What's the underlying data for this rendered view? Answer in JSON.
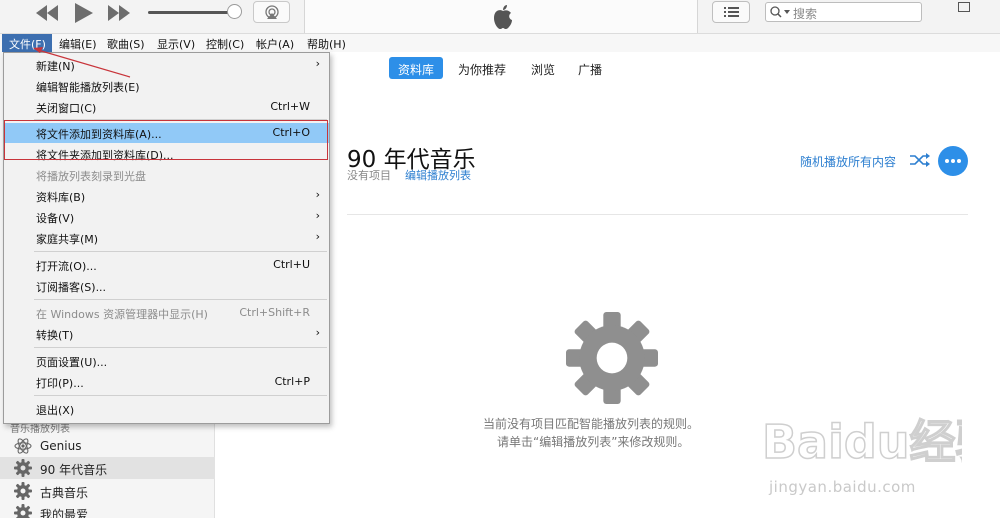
{
  "toolbar": {
    "search_placeholder": "搜索",
    "icons": [
      "rewind-icon",
      "play-icon",
      "fast-forward-icon",
      "airplay-icon",
      "apple-logo",
      "list-view-icon",
      "search-icon"
    ]
  },
  "menubar": {
    "items": [
      "文件(F)",
      "编辑(E)",
      "歌曲(S)",
      "显示(V)",
      "控制(C)",
      "帐户(A)",
      "帮助(H)"
    ]
  },
  "file_menu": {
    "items": [
      {
        "label": "新建(N)",
        "shortcut": "",
        "submenu": true,
        "disabled": false
      },
      {
        "label": "编辑智能播放列表(E)",
        "shortcut": "",
        "submenu": false,
        "disabled": false
      },
      {
        "label": "关闭窗口(C)",
        "shortcut": "Ctrl+W",
        "submenu": false,
        "disabled": false
      },
      {
        "label": "将文件添加到资料库(A)...",
        "shortcut": "Ctrl+O",
        "submenu": false,
        "disabled": false,
        "highlighted": true
      },
      {
        "label": "将文件夹添加到资料库(D)...",
        "shortcut": "",
        "submenu": false,
        "disabled": false
      },
      {
        "label": "将播放列表刻录到光盘",
        "shortcut": "",
        "submenu": false,
        "disabled": true
      },
      {
        "label": "资料库(B)",
        "shortcut": "",
        "submenu": true,
        "disabled": false
      },
      {
        "label": "设备(V)",
        "shortcut": "",
        "submenu": true,
        "disabled": false
      },
      {
        "label": "家庭共享(M)",
        "shortcut": "",
        "submenu": true,
        "disabled": false
      },
      {
        "label": "打开流(O)...",
        "shortcut": "Ctrl+U",
        "submenu": false,
        "disabled": false
      },
      {
        "label": "订阅播客(S)...",
        "shortcut": "",
        "submenu": false,
        "disabled": false
      },
      {
        "label": "在 Windows 资源管理器中显示(H)",
        "shortcut": "Ctrl+Shift+R",
        "submenu": false,
        "disabled": true
      },
      {
        "label": "转换(T)",
        "shortcut": "",
        "submenu": true,
        "disabled": false
      },
      {
        "label": "页面设置(U)...",
        "shortcut": "",
        "submenu": false,
        "disabled": false
      },
      {
        "label": "打印(P)...",
        "shortcut": "Ctrl+P",
        "submenu": false,
        "disabled": false
      },
      {
        "label": "退出(X)",
        "shortcut": "",
        "submenu": false,
        "disabled": false
      }
    ]
  },
  "tabs": [
    "资料库",
    "为你推荐",
    "浏览",
    "广播"
  ],
  "active_tab": "资料库",
  "sidebar": {
    "section_title": "音乐播放列表",
    "items": [
      {
        "label": "Genius",
        "icon": "genius-atom-icon"
      },
      {
        "label": "90 年代音乐",
        "icon": "gear-icon",
        "selected": true
      },
      {
        "label": "古典音乐",
        "icon": "gear-icon"
      },
      {
        "label": "我的最爱",
        "icon": "gear-icon"
      }
    ]
  },
  "playlist": {
    "title": "90 年代音乐",
    "item_count": "没有项目",
    "edit_link": "编辑播放列表",
    "shuffle_label": "随机播放所有内容",
    "empty_line1": "当前没有项目匹配智能播放列表的规则。",
    "empty_line2": "请单击“编辑播放列表”来修改规则。"
  },
  "watermark": {
    "brand": "Baidu经验",
    "url": "jingyan.baidu.com"
  },
  "colors": {
    "accent": "#2d8fe8",
    "menu_highlight": "#91c9f7",
    "annotation_red": "#c8343a"
  }
}
